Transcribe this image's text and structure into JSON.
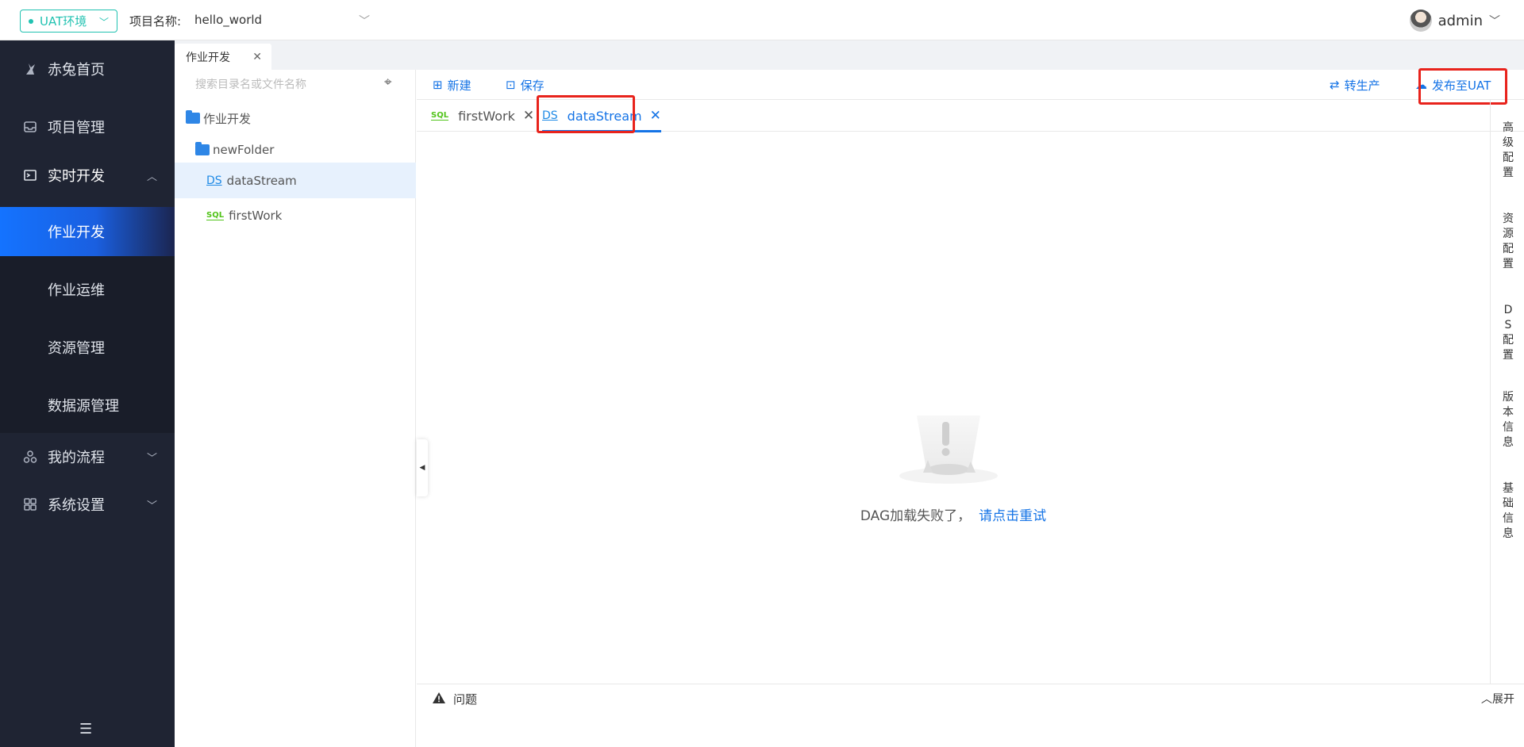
{
  "topbar": {
    "env_label": "UAT环境",
    "project_label": "项目名称:",
    "project_name": "hello_world",
    "user_name": "admin"
  },
  "sidebar": {
    "items": [
      {
        "label": "赤兔首页",
        "icon": "rabbit-icon"
      },
      {
        "label": "项目管理",
        "icon": "inbox-icon"
      },
      {
        "label": "实时开发",
        "icon": "terminal-icon"
      }
    ],
    "sub_items": [
      {
        "label": "作业开发"
      },
      {
        "label": "作业运维"
      },
      {
        "label": "资源管理"
      },
      {
        "label": "数据源管理"
      }
    ],
    "bottom_items": [
      {
        "label": "我的流程",
        "icon": "flow-icon"
      },
      {
        "label": "系统设置",
        "icon": "grid-icon"
      }
    ]
  },
  "page_tab": {
    "label": "作业开发"
  },
  "tree": {
    "search_placeholder": "搜索目录名或文件名称",
    "root": "作业开发",
    "folder": "newFolder",
    "files": [
      {
        "tag": "DS",
        "name": "dataStream"
      },
      {
        "tag": "SQL",
        "name": "firstWork"
      }
    ]
  },
  "toolbar": {
    "new_label": "新建",
    "save_label": "保存",
    "to_prod_label": "转生产",
    "publish_label": "发布至UAT"
  },
  "file_tabs": [
    {
      "tag": "SQL",
      "name": "firstWork"
    },
    {
      "tag": "DS",
      "name": "dataStream"
    }
  ],
  "canvas": {
    "error_text": "DAG加载失败了，",
    "retry_text": "请点击重试"
  },
  "right_rail": [
    "高级配置",
    "资源配置",
    "DS配置",
    "版本信息",
    "基础信息"
  ],
  "bottom": {
    "issue_label": "问题",
    "expand_label": "展开"
  },
  "colors": {
    "sidebar_bg": "#1f2433",
    "accent": "#1473e6",
    "env_teal": "#21c2b1",
    "highlight_red": "#e8231c"
  }
}
